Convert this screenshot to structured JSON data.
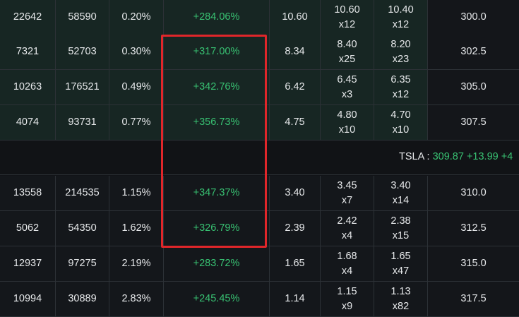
{
  "ticker": {
    "symbol": "TSLA :",
    "price": "309.87",
    "change": "+13.99",
    "extra": "+4"
  },
  "highlight_color": "#e0262a",
  "colors": {
    "positive": "#38c172",
    "itm_bg": "#172623",
    "otm_bg": "#14171b"
  },
  "rows_top": [
    {
      "c0": "22642",
      "c1": "58590",
      "c2": "0.20%",
      "c3": "+284.06%",
      "c4": "10.60",
      "c5a": "10.60",
      "c5b": "x12",
      "c6a": "10.40",
      "c6b": "x12",
      "c7": "300.0"
    },
    {
      "c0": "7321",
      "c1": "52703",
      "c2": "0.30%",
      "c3": "+317.00%",
      "c4": "8.34",
      "c5a": "8.40",
      "c5b": "x25",
      "c6a": "8.20",
      "c6b": "x23",
      "c7": "302.5"
    },
    {
      "c0": "10263",
      "c1": "176521",
      "c2": "0.49%",
      "c3": "+342.76%",
      "c4": "6.42",
      "c5a": "6.45",
      "c5b": "x3",
      "c6a": "6.35",
      "c6b": "x12",
      "c7": "305.0"
    },
    {
      "c0": "4074",
      "c1": "93731",
      "c2": "0.77%",
      "c3": "+356.73%",
      "c4": "4.75",
      "c5a": "4.80",
      "c5b": "x10",
      "c6a": "4.70",
      "c6b": "x10",
      "c7": "307.5"
    }
  ],
  "rows_bottom": [
    {
      "c0": "13558",
      "c1": "214535",
      "c2": "1.15%",
      "c3": "+347.37%",
      "c4": "3.40",
      "c5a": "3.45",
      "c5b": "x7",
      "c6a": "3.40",
      "c6b": "x14",
      "c7": "310.0"
    },
    {
      "c0": "5062",
      "c1": "54350",
      "c2": "1.62%",
      "c3": "+326.79%",
      "c4": "2.39",
      "c5a": "2.42",
      "c5b": "x4",
      "c6a": "2.38",
      "c6b": "x15",
      "c7": "312.5"
    },
    {
      "c0": "12937",
      "c1": "97275",
      "c2": "2.19%",
      "c3": "+283.72%",
      "c4": "1.65",
      "c5a": "1.68",
      "c5b": "x4",
      "c6a": "1.65",
      "c6b": "x47",
      "c7": "315.0"
    },
    {
      "c0": "10994",
      "c1": "30889",
      "c2": "2.83%",
      "c3": "+245.45%",
      "c4": "1.14",
      "c5a": "1.15",
      "c5b": "x9",
      "c6a": "1.13",
      "c6b": "x82",
      "c7": "317.5"
    }
  ]
}
